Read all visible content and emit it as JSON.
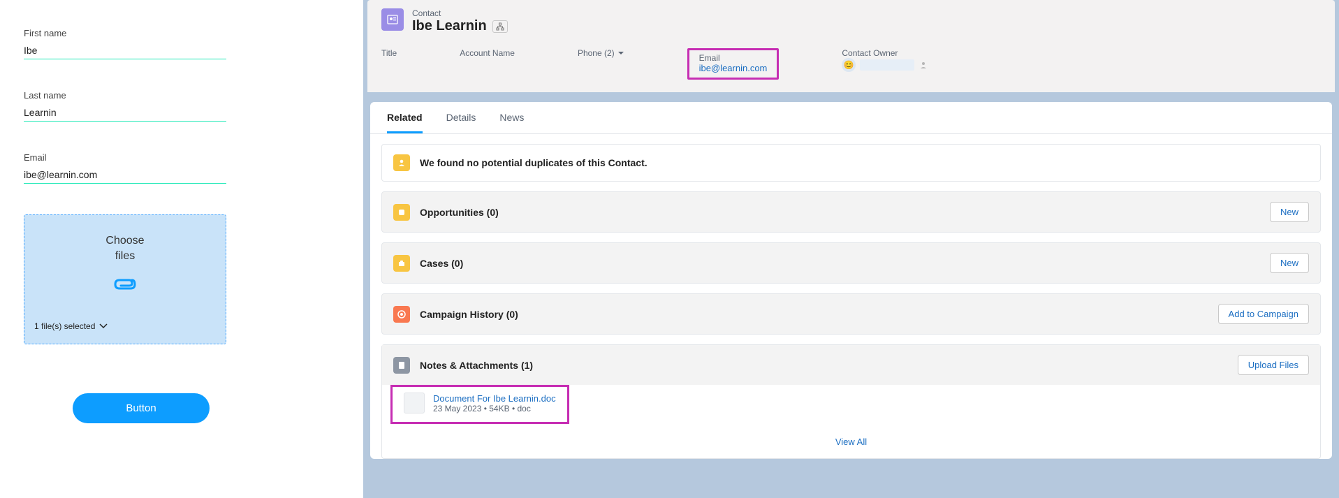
{
  "form": {
    "first_name_label": "First name",
    "first_name_value": "Ibe",
    "last_name_label": "Last name",
    "last_name_value": "Learnin",
    "email_label": "Email",
    "email_value": "ibe@learnin.com",
    "choose_files_label": "Choose\nfiles",
    "selected_text": "1 file(s) selected",
    "submit_label": "Button"
  },
  "record": {
    "object_label": "Contact",
    "name": "Ibe Learnin",
    "fields": {
      "title_label": "Title",
      "account_label": "Account Name",
      "phone_label": "Phone (2)",
      "email_label": "Email",
      "email_value": "ibe@learnin.com",
      "owner_label": "Contact Owner"
    }
  },
  "tabs": {
    "related": "Related",
    "details": "Details",
    "news": "News"
  },
  "sections": {
    "duplicates_msg": "We found no potential duplicates of this Contact.",
    "opportunities_title": "Opportunities (0)",
    "cases_title": "Cases (0)",
    "campaign_title": "Campaign History (0)",
    "notes_title": "Notes & Attachments (1)",
    "new_label": "New",
    "add_campaign_label": "Add to Campaign",
    "upload_label": "Upload Files",
    "view_all": "View All"
  },
  "attachment": {
    "name": "Document For Ibe  Learnin.doc",
    "meta": "23 May 2023  •  54KB  •  doc"
  }
}
